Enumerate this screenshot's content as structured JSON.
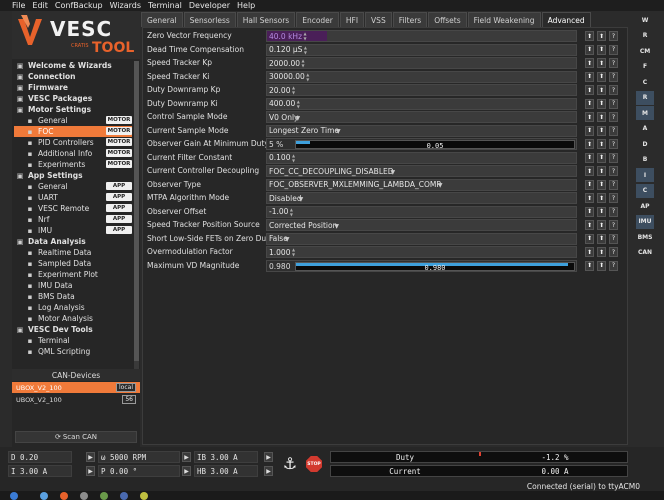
{
  "menubar": [
    "File",
    "Edit",
    "ConfBackup",
    "Wizards",
    "Terminal",
    "Developer",
    "Help"
  ],
  "logo": {
    "brand": "VESC",
    "tool": "TOOL",
    "tagline": "CRATIS"
  },
  "tree": [
    {
      "label": "Welcome & Wizards",
      "level": "top",
      "icon": "home-icon"
    },
    {
      "label": "Connection",
      "level": "top",
      "icon": "connection-icon"
    },
    {
      "label": "Firmware",
      "level": "top",
      "icon": "firmware-icon"
    },
    {
      "label": "VESC Packages",
      "level": "top",
      "icon": "package-icon"
    },
    {
      "label": "Motor Settings",
      "level": "top",
      "icon": "motor-icon"
    },
    {
      "label": "General",
      "level": "sub",
      "icon": "gear-icon",
      "badge": "MOTOR"
    },
    {
      "label": "FOC",
      "level": "sub",
      "icon": "foc-icon",
      "badge": "MOTOR",
      "selected": true
    },
    {
      "label": "PID Controllers",
      "level": "sub",
      "icon": "pid-icon",
      "badge": "MOTOR"
    },
    {
      "label": "Additional Info",
      "level": "sub",
      "icon": "info-icon",
      "badge": "MOTOR"
    },
    {
      "label": "Experiments",
      "level": "sub",
      "icon": "experiment-icon",
      "badge": "MOTOR"
    },
    {
      "label": "App Settings",
      "level": "top",
      "icon": "app-icon"
    },
    {
      "label": "General",
      "level": "sub",
      "icon": "gear-icon",
      "badge": "APP"
    },
    {
      "label": "UART",
      "level": "sub",
      "icon": "uart-icon",
      "badge": "APP"
    },
    {
      "label": "VESC Remote",
      "level": "sub",
      "icon": "remote-icon",
      "badge": "APP"
    },
    {
      "label": "Nrf",
      "level": "sub",
      "icon": "nrf-icon",
      "badge": "APP"
    },
    {
      "label": "IMU",
      "level": "sub",
      "icon": "imu-icon",
      "badge": "APP"
    },
    {
      "label": "Data Analysis",
      "level": "top",
      "icon": "chart-icon"
    },
    {
      "label": "Realtime Data",
      "level": "sub",
      "icon": "realtime-icon"
    },
    {
      "label": "Sampled Data",
      "level": "sub",
      "icon": "sampled-icon"
    },
    {
      "label": "Experiment Plot",
      "level": "sub",
      "icon": "plot-icon"
    },
    {
      "label": "IMU Data",
      "level": "sub",
      "icon": "imu-icon"
    },
    {
      "label": "BMS Data",
      "level": "sub",
      "icon": "bms-icon"
    },
    {
      "label": "Log Analysis",
      "level": "sub",
      "icon": "log-icon"
    },
    {
      "label": "Motor Analysis",
      "level": "sub",
      "icon": "motor-analysis-icon"
    },
    {
      "label": "VESC Dev Tools",
      "level": "top",
      "icon": "devtools-icon"
    },
    {
      "label": "Terminal",
      "level": "sub",
      "icon": "terminal-icon"
    },
    {
      "label": "QML Scripting",
      "level": "sub",
      "icon": "script-icon"
    }
  ],
  "can": {
    "header": "CAN-Devices",
    "devices": [
      {
        "name": "UBOX_V2_100",
        "tag": "local",
        "selected": true
      },
      {
        "name": "UBOX_V2_100",
        "tag": "56",
        "selected": false
      }
    ],
    "scan_label": "Scan CAN"
  },
  "tabs": [
    "General",
    "Sensorless",
    "Hall Sensors",
    "Encoder",
    "HFI",
    "VSS",
    "Filters",
    "Offsets",
    "Field Weakening",
    "Advanced"
  ],
  "active_tab": "Advanced",
  "params": [
    {
      "label": "Zero Vector Frequency",
      "value": "40.0 kHz",
      "kind": "spin",
      "highlight": true
    },
    {
      "label": "Dead Time Compensation",
      "value": "0.120 µS",
      "kind": "spin"
    },
    {
      "label": "Speed Tracker Kp",
      "value": "2000.00",
      "kind": "spin"
    },
    {
      "label": "Speed Tracker Ki",
      "value": "30000.00",
      "kind": "spin"
    },
    {
      "label": "Duty Downramp Kp",
      "value": "20.00",
      "kind": "spin"
    },
    {
      "label": "Duty Downramp Ki",
      "value": "400.00",
      "kind": "spin"
    },
    {
      "label": "Control Sample Mode",
      "value": "V0 Only",
      "kind": "dropdown"
    },
    {
      "label": "Current Sample Mode",
      "value": "Longest Zero Time",
      "kind": "dropdown"
    },
    {
      "label": "Observer Gain At Minimum Duty",
      "value": "5 %",
      "kind": "slider",
      "bar_text": "0.05",
      "fraction": 0.05
    },
    {
      "label": "Current Filter Constant",
      "value": "0.100",
      "kind": "spin"
    },
    {
      "label": "Current Controller Decoupling",
      "value": "FOC_CC_DECOUPLING_DISABLED",
      "kind": "dropdown"
    },
    {
      "label": "Observer Type",
      "value": "FOC_OBSERVER_MXLEMMING_LAMBDA_COMP",
      "kind": "dropdown"
    },
    {
      "label": "MTPA Algorithm Mode",
      "value": "Disabled",
      "kind": "dropdown"
    },
    {
      "label": "Observer Offset",
      "value": "-1.00",
      "kind": "spin"
    },
    {
      "label": "Speed Tracker Position Source",
      "value": "Corrected Position",
      "kind": "dropdown"
    },
    {
      "label": "Short Low-Side FETs on Zero Duty",
      "value": "False",
      "kind": "dropdown"
    },
    {
      "label": "Overmodulation Factor",
      "value": "1.000",
      "kind": "spin"
    },
    {
      "label": "Maximum VD Magnitude",
      "value": "0.980",
      "kind": "slider",
      "bar_text": "0.980",
      "fraction": 0.98
    }
  ],
  "right_toolbar": [
    "W",
    "R",
    "CM",
    "F",
    "C",
    "R",
    "M",
    "A",
    "D",
    "B",
    "I",
    "C",
    "AP",
    "IMU",
    "BMS",
    "CAN"
  ],
  "bottom": {
    "d_label": "D",
    "d_value": "0.20",
    "w_label": "ω",
    "w_value": "5000 RPM",
    "ib_label": "IB",
    "ib_value": "3.00 A",
    "i_label": "I",
    "i_value": "3.00 A",
    "p_label": "P",
    "p_value": "0.00 °",
    "hb_label": "HB",
    "hb_value": "3.00 A",
    "stop_label": "STOP",
    "duty_label": "Duty",
    "duty_value": "-1.2 %",
    "current_label": "Current",
    "current_value": "0.00 A"
  },
  "status": "Connected (serial) to ttyACM0"
}
